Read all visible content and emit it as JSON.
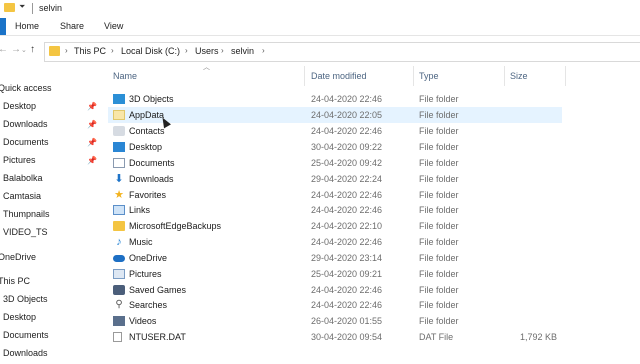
{
  "window": {
    "title": "selvin"
  },
  "ribbon": {
    "tabs": [
      "Home",
      "Share",
      "View"
    ]
  },
  "address": {
    "crumbs": [
      "This PC",
      "Local Disk (C:)",
      "Users",
      "selvin"
    ]
  },
  "sidebar": {
    "items": [
      {
        "label": "Quick access",
        "pinned": false
      },
      {
        "label": "Desktop",
        "pinned": true
      },
      {
        "label": "Downloads",
        "pinned": true
      },
      {
        "label": "Documents",
        "pinned": true
      },
      {
        "label": "Pictures",
        "pinned": true
      },
      {
        "label": "Balabolka",
        "pinned": false
      },
      {
        "label": "Camtasia",
        "pinned": false
      },
      {
        "label": "Thumpnails",
        "pinned": false
      },
      {
        "label": "VIDEO_TS",
        "pinned": false
      },
      {
        "label": "OneDrive",
        "pinned": false
      },
      {
        "label": "This PC",
        "pinned": false
      },
      {
        "label": "3D Objects",
        "pinned": false
      },
      {
        "label": "Desktop",
        "pinned": false
      },
      {
        "label": "Documents",
        "pinned": false
      },
      {
        "label": "Downloads",
        "pinned": false
      }
    ]
  },
  "columns": {
    "name": "Name",
    "date": "Date modified",
    "type": "Type",
    "size": "Size"
  },
  "files": [
    {
      "name": "3D Objects",
      "date": "24-04-2020 22:46",
      "type": "File folder",
      "size": "",
      "icon": "3d-objects-icon"
    },
    {
      "name": "AppData",
      "date": "24-04-2020 22:05",
      "type": "File folder",
      "size": "",
      "icon": "folder-icon"
    },
    {
      "name": "Contacts",
      "date": "24-04-2020 22:46",
      "type": "File folder",
      "size": "",
      "icon": "contacts-icon"
    },
    {
      "name": "Desktop",
      "date": "30-04-2020 09:22",
      "type": "File folder",
      "size": "",
      "icon": "desktop-icon"
    },
    {
      "name": "Documents",
      "date": "25-04-2020 09:42",
      "type": "File folder",
      "size": "",
      "icon": "documents-icon"
    },
    {
      "name": "Downloads",
      "date": "29-04-2020 22:24",
      "type": "File folder",
      "size": "",
      "icon": "downloads-icon"
    },
    {
      "name": "Favorites",
      "date": "24-04-2020 22:46",
      "type": "File folder",
      "size": "",
      "icon": "star-icon"
    },
    {
      "name": "Links",
      "date": "24-04-2020 22:46",
      "type": "File folder",
      "size": "",
      "icon": "links-icon"
    },
    {
      "name": "MicrosoftEdgeBackups",
      "date": "24-04-2020 22:10",
      "type": "File folder",
      "size": "",
      "icon": "folder-icon"
    },
    {
      "name": "Music",
      "date": "24-04-2020 22:46",
      "type": "File folder",
      "size": "",
      "icon": "music-icon"
    },
    {
      "name": "OneDrive",
      "date": "29-04-2020 23:14",
      "type": "File folder",
      "size": "",
      "icon": "onedrive-icon"
    },
    {
      "name": "Pictures",
      "date": "25-04-2020 09:21",
      "type": "File folder",
      "size": "",
      "icon": "pictures-icon"
    },
    {
      "name": "Saved Games",
      "date": "24-04-2020 22:46",
      "type": "File folder",
      "size": "",
      "icon": "saved-games-icon"
    },
    {
      "name": "Searches",
      "date": "24-04-2020 22:46",
      "type": "File folder",
      "size": "",
      "icon": "search-icon"
    },
    {
      "name": "Videos",
      "date": "26-04-2020 01:55",
      "type": "File folder",
      "size": "",
      "icon": "videos-icon"
    },
    {
      "name": "NTUSER.DAT",
      "date": "30-04-2020 09:54",
      "type": "DAT File",
      "size": "1,792 KB",
      "icon": "file-icon"
    }
  ]
}
